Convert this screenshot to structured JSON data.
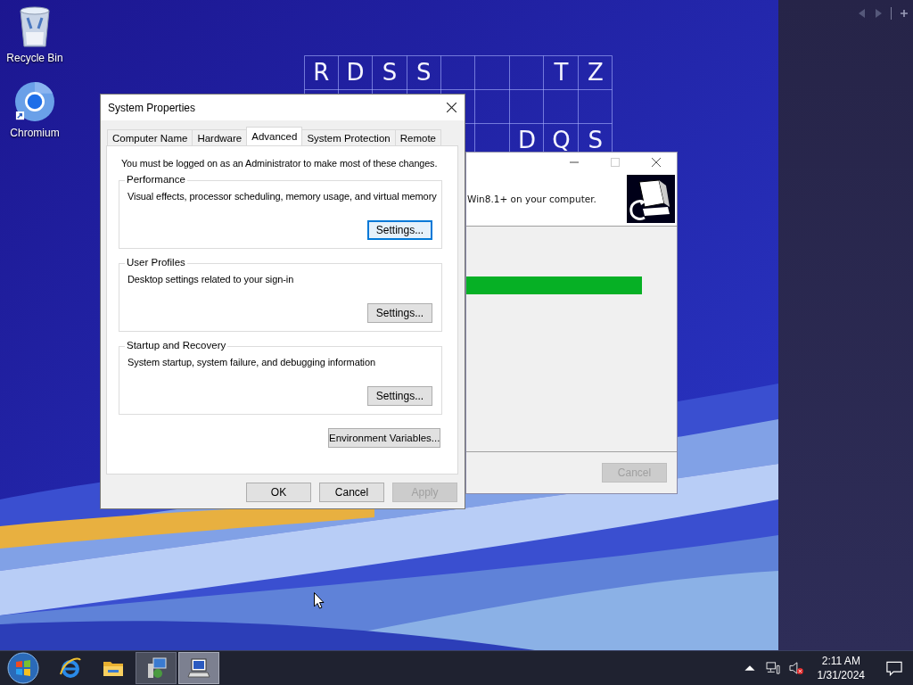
{
  "desktop": {
    "icons": [
      {
        "kind": "recycle",
        "label": "Recycle Bin"
      },
      {
        "kind": "chromium",
        "label": "Chromium"
      }
    ],
    "letter_grid": {
      "top_row": {
        "left_letters": [
          "R",
          "D",
          "S",
          "S"
        ],
        "right_letters": [
          "T",
          "Z"
        ]
      },
      "bottom_row": {
        "right_letters": [
          "D",
          "Q",
          "S"
        ]
      }
    }
  },
  "installer_window": {
    "header_text": "Win8.1+ on your computer.",
    "cancel": {
      "label": "Cancel",
      "disabled": true
    }
  },
  "system_properties": {
    "title": "System Properties",
    "tabs": [
      {
        "label": "Computer Name",
        "selected": false
      },
      {
        "label": "Hardware",
        "selected": false
      },
      {
        "label": "Advanced",
        "selected": true
      },
      {
        "label": "System Protection",
        "selected": false
      },
      {
        "label": "Remote",
        "selected": false
      }
    ],
    "notice": "You must be logged on as an Administrator to make most of these changes.",
    "groups": [
      {
        "title": "Performance",
        "description": "Visual effects, processor scheduling, memory usage, and virtual memory",
        "button": {
          "label": "Settings...",
          "focused": true
        }
      },
      {
        "title": "User Profiles",
        "description": "Desktop settings related to your sign-in",
        "button": {
          "label": "Settings...",
          "focused": false
        }
      },
      {
        "title": "Startup and Recovery",
        "description": "System startup, system failure, and debugging information",
        "button": {
          "label": "Settings...",
          "focused": false
        }
      }
    ],
    "environment_button": "Environment Variables...",
    "buttons": [
      {
        "label": "OK",
        "disabled": false
      },
      {
        "label": "Cancel",
        "disabled": false
      },
      {
        "label": "Apply",
        "disabled": true
      }
    ]
  },
  "taskbar": {
    "apps": [
      {
        "kind": "ie",
        "running": false,
        "selected": false
      },
      {
        "kind": "folder",
        "running": false,
        "selected": false
      },
      {
        "kind": "system",
        "running": true,
        "selected": false
      },
      {
        "kind": "installer",
        "running": true,
        "selected": true
      }
    ],
    "volume_muted": true,
    "clock": {
      "time": "2:11 AM",
      "date": "1/31/2024"
    }
  }
}
